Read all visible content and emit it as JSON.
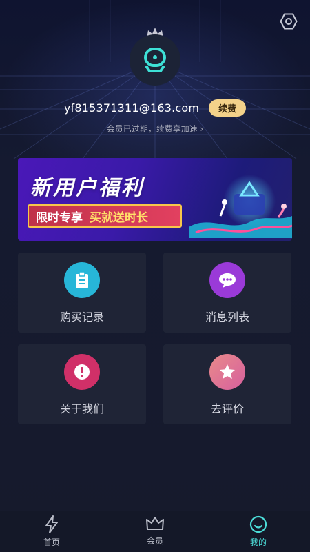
{
  "profile": {
    "email": "yf815371311@163.com",
    "renew_label": "续费",
    "status_text": "会员已过期，续费享加速 ›"
  },
  "banner": {
    "title": "新用户福利",
    "sub_left": "限时专享",
    "sub_right": "买就送时长"
  },
  "cards": [
    {
      "label": "购买记录",
      "icon": "clipboard-icon",
      "color": "#27b6d8"
    },
    {
      "label": "消息列表",
      "icon": "chat-bubble-icon",
      "color": "#9a3ad8"
    },
    {
      "label": "关于我们",
      "icon": "alert-circle-icon",
      "color": "#d03068"
    },
    {
      "label": "去评价",
      "icon": "star-icon",
      "color": "#e07a9a"
    }
  ],
  "tabs": [
    {
      "label": "首页",
      "icon": "lightning-icon"
    },
    {
      "label": "会员",
      "icon": "crown-icon"
    },
    {
      "label": "我的",
      "icon": "face-icon",
      "active": true
    }
  ],
  "colors": {
    "accent": "#4cdcd8",
    "renew": "#f3d28a",
    "card": "#1f2436"
  }
}
